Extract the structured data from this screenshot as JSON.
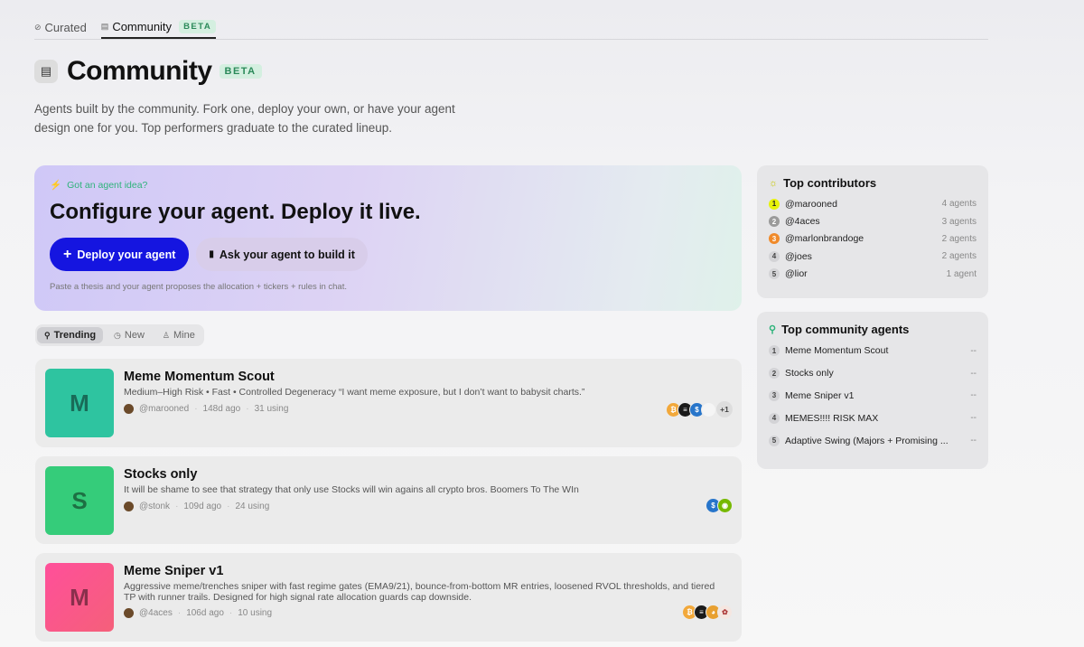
{
  "tabs": [
    {
      "label": "Curated",
      "active": false
    },
    {
      "label": "Community",
      "active": true,
      "badge": "BETA"
    }
  ],
  "header": {
    "title": "Community",
    "badge": "BETA",
    "description": "Agents built by the community. Fork one, deploy your own, or have your agent design one for you. Top performers graduate to the curated lineup."
  },
  "hero": {
    "eyebrow": "Got an agent idea?",
    "title": "Configure your agent. Deploy it live.",
    "primary_button": "Deploy your agent",
    "secondary_button": "Ask your agent to build it",
    "hint": "Paste a thesis and your agent proposes the allocation + tickers + rules in chat."
  },
  "filters": [
    {
      "label": "Trending",
      "active": true
    },
    {
      "label": "New",
      "active": false
    },
    {
      "label": "Mine",
      "active": false
    }
  ],
  "agents": [
    {
      "letter": "M",
      "thumb_color": "#2ec4a0",
      "title": "Meme Momentum Scout",
      "description": "Medium–High Risk • Fast • Controlled Degeneracy “I want meme exposure, but I don’t want to babysit charts.”",
      "author": "@marooned",
      "age": "148d ago",
      "using": "31 using",
      "more": "+1"
    },
    {
      "letter": "S",
      "thumb_color": "#35cc7a",
      "title": "Stocks only",
      "description": "It will be shame to see that strategy that only use Stocks will win agains all crypto bros. Boomers To The WIn",
      "author": "@stonk",
      "age": "109d ago",
      "using": "24 using"
    },
    {
      "letter": "M",
      "thumb_color": "#f2568c",
      "title": "Meme Sniper v1",
      "description": "Aggressive meme/trenches sniper with fast regime gates (EMA9/21), bounce-from-bottom MR entries, loosened RVOL thresholds, and tiered TP with runner trails. Designed for high signal rate allocation guards cap downside.",
      "author": "@4aces",
      "age": "106d ago",
      "using": "10 using"
    }
  ],
  "contributors": {
    "title": "Top contributors",
    "rows": [
      {
        "rank": "1",
        "name": "@marooned",
        "count": "4 agents",
        "rank_color": "#e6f20a"
      },
      {
        "rank": "2",
        "name": "@4aces",
        "count": "3 agents",
        "rank_color": "#9a9a9a"
      },
      {
        "rank": "3",
        "name": "@marlonbrandoge",
        "count": "2 agents",
        "rank_color": "#f08a2a"
      },
      {
        "rank": "4",
        "name": "@joes",
        "count": "2 agents",
        "rank_color": "#d3d3d6"
      },
      {
        "rank": "5",
        "name": "@lior",
        "count": "1 agent",
        "rank_color": "#d3d3d6"
      }
    ]
  },
  "top_agents": {
    "title": "Top community agents",
    "rows": [
      {
        "rank": "1",
        "name": "Meme Momentum Scout",
        "value": "--"
      },
      {
        "rank": "2",
        "name": "Stocks only",
        "value": "--"
      },
      {
        "rank": "3",
        "name": "Meme Sniper v1",
        "value": "--"
      },
      {
        "rank": "4",
        "name": "MEMES!!!! RISK MAX",
        "value": "--"
      },
      {
        "rank": "5",
        "name": "Adaptive Swing (Majors + Promising ...",
        "value": "--"
      }
    ]
  }
}
